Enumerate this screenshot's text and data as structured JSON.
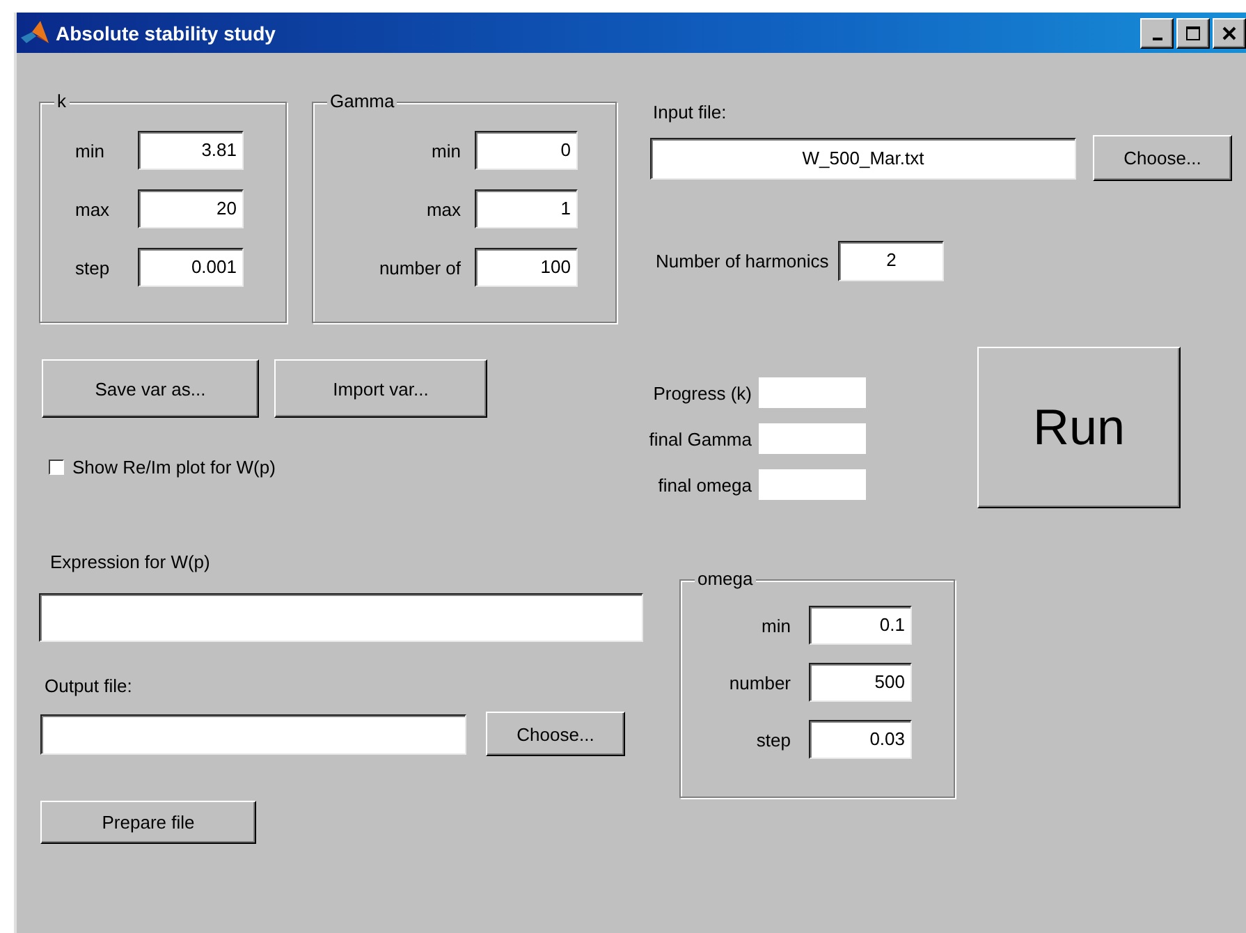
{
  "window": {
    "title": "Absolute stability study"
  },
  "frames": [
    {
      "kind": "k",
      "legend": "k",
      "fields": [
        {
          "label": "min",
          "value": "3.81"
        },
        {
          "label": "max",
          "value": "20"
        },
        {
          "label": "step",
          "value": "0.001"
        }
      ]
    },
    {
      "kind": "gamma",
      "legend": "Gamma",
      "fields": [
        {
          "label": "min",
          "value": "0"
        },
        {
          "label": "max",
          "value": "1"
        },
        {
          "label": "number of",
          "value": "100"
        }
      ]
    },
    {
      "kind": "omega",
      "legend": "omega",
      "fields": [
        {
          "label": "min",
          "value": "0.1"
        },
        {
          "label": "number",
          "value": "500"
        },
        {
          "label": "step",
          "value": "0.03"
        }
      ]
    }
  ],
  "input_file": {
    "label": "Input file:",
    "value": "W_500_Mar.txt",
    "button": "Choose..."
  },
  "harmonics": {
    "label": "Number of harmonics",
    "value": "2"
  },
  "var_buttons": [
    "Save var as...",
    "Import var..."
  ],
  "checkbox": {
    "label": "Show Re/Im plot for W(p)",
    "checked": false
  },
  "progress": [
    {
      "label": "Progress (k)"
    },
    {
      "label": "final Gamma"
    },
    {
      "label": "final omega"
    }
  ],
  "run_button": "Run",
  "expression": {
    "label": "Expression for W(p)"
  },
  "output_file": {
    "label": "Output file:",
    "button": "Choose..."
  },
  "prepare_button": "Prepare file"
}
